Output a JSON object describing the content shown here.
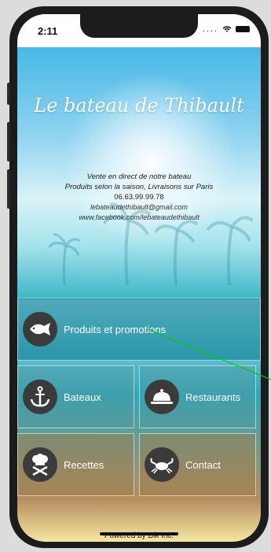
{
  "status_bar": {
    "time": "2:11",
    "signal": "....",
    "wifi": "wifi-icon",
    "battery": "battery-icon"
  },
  "hero": {
    "title": "Le bateau de Thibault",
    "lines": [
      "Vente en direct de notre bateau",
      "Produits selon la saison, Livraisons sur Paris",
      "06.63.99.99.78",
      "lebateaudethibault@gmail.com",
      "www.facebook.com/lebateaudethibault"
    ]
  },
  "menu": {
    "produits": {
      "label": "Produits et promotions",
      "icon": "fish-icon"
    },
    "bateaux": {
      "label": "Bateaux",
      "icon": "anchor-icon"
    },
    "restaurants": {
      "label": "Restaurants",
      "icon": "cloche-icon"
    },
    "recettes": {
      "label": "Recettes",
      "icon": "chef-hat-icon"
    },
    "contact": {
      "label": "Contact",
      "icon": "crab-icon"
    }
  },
  "footer": {
    "powered_by": "Powered by Bik Inc."
  },
  "colors": {
    "icon_bg": "#3b3b3b",
    "tile_text": "#ffffff",
    "annotation_line": "#00cc00"
  }
}
